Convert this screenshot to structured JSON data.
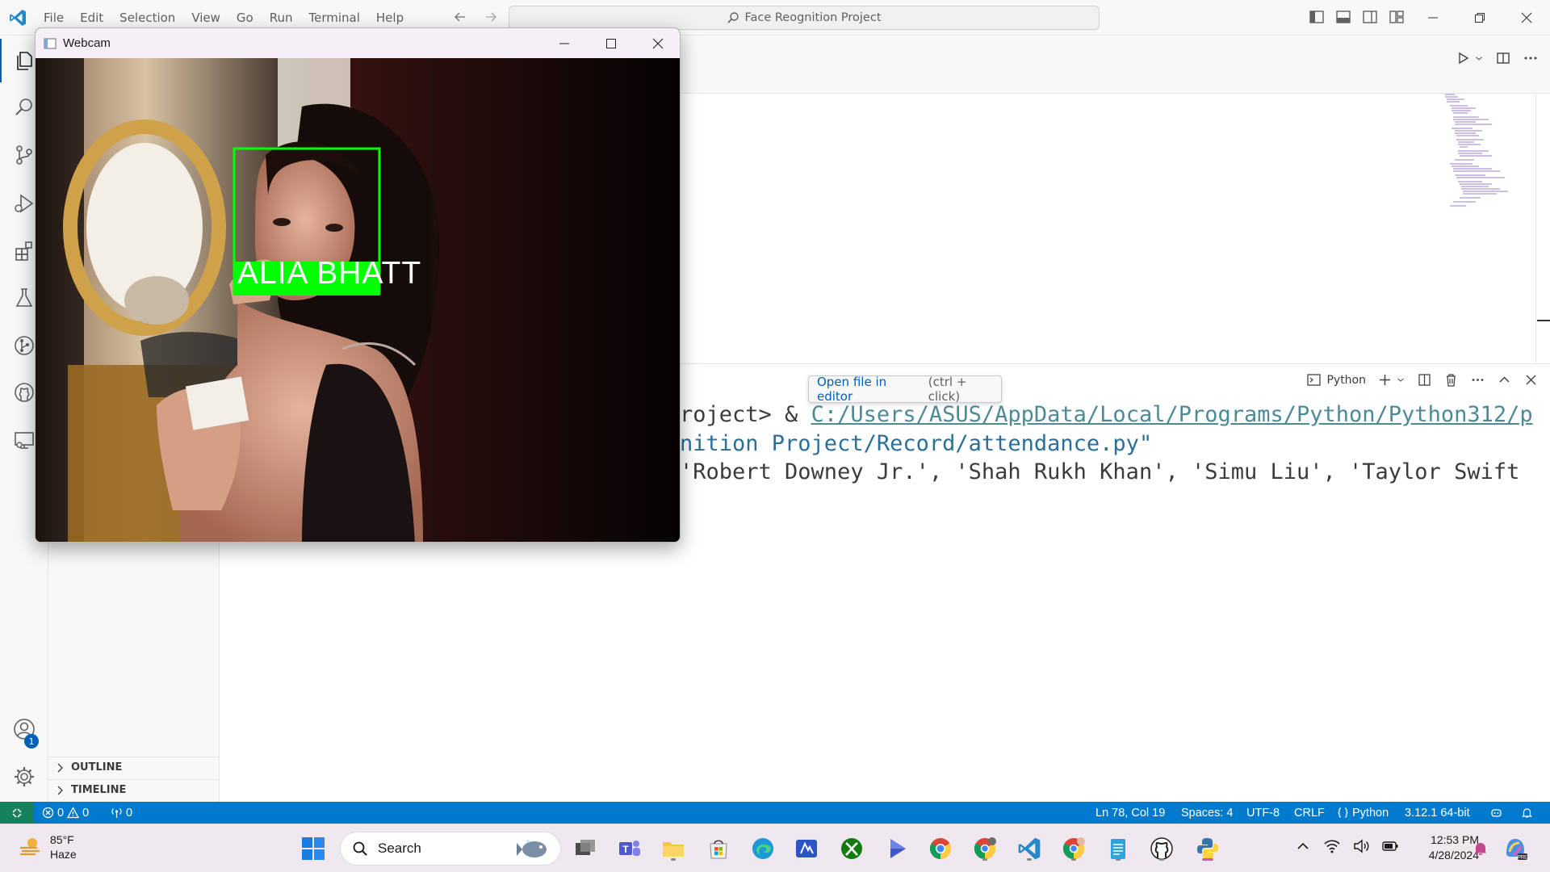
{
  "titlebar": {
    "menus": [
      "File",
      "Edit",
      "Selection",
      "View",
      "Go",
      "Run",
      "Terminal",
      "Help"
    ],
    "command_center": "Face Reognition Project"
  },
  "activitybar": {
    "items": [
      "explorer-icon",
      "search-icon",
      "source-control-icon",
      "run-debug-icon",
      "extensions-icon",
      "testing-icon",
      "git-graph-icon",
      "github-icon",
      "remote-explorer-icon"
    ],
    "accounts_badge": "1"
  },
  "sidebar": {
    "outline_label": "OUTLINE",
    "timeline_label": "TIMELINE"
  },
  "panel": {
    "shell_label": "Python",
    "tooltip_link": "Open file in editor",
    "tooltip_hint": "(ctrl + click)",
    "term_line1_prefix": "roject> & ",
    "term_line1_path": "C:/Users/ASUS/AppData/Local/Programs/Python/Python312/p",
    "term_line2": "nition Project/Record/attendance.py\"",
    "term_line3": " 'Robert Downey Jr.', 'Shah Rukh Khan', 'Simu Liu', 'Taylor Swift"
  },
  "webcam": {
    "title": "Webcam",
    "face_label": "ALIA  BHATT"
  },
  "statusbar": {
    "errors": "0",
    "warnings": "0",
    "ports": "0",
    "position": "Ln 78, Col 19",
    "spaces": "Spaces: 4",
    "encoding": "UTF-8",
    "eol": "CRLF",
    "language": "Python",
    "interpreter": "3.12.1 64-bit"
  },
  "taskbar": {
    "weather_temp": "85°F",
    "weather_desc": "Haze",
    "search_placeholder": "Search",
    "apps": [
      "task-view-icon",
      "teams-icon",
      "file-explorer-icon",
      "ms-store-icon",
      "edge-icon",
      "visual-studio-icon",
      "xbox-icon",
      "media-player-icon",
      "chrome-icon",
      "chrome-profile-icon",
      "vscode-icon",
      "chrome-alt-icon",
      "notepad-icon",
      "github-desktop-icon",
      "python-icon"
    ],
    "time": "12:53 PM",
    "date": "4/28/2024"
  },
  "colors": {
    "accent": "#005fb8",
    "statusbar": "#007acc",
    "remote": "#16825d",
    "face_box": "#00ff00"
  }
}
